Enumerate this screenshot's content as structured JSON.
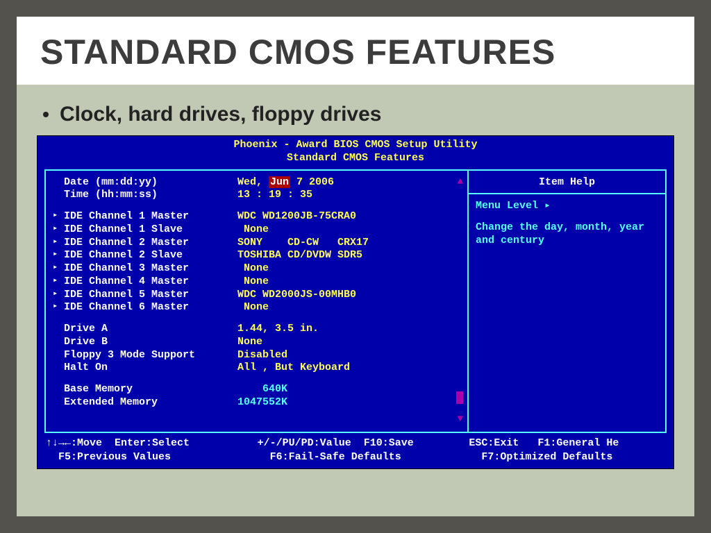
{
  "slide": {
    "title": "STANDARD CMOS FEATURES",
    "bullet": "Clock, hard drives, floppy drives"
  },
  "bios": {
    "header": {
      "line1": "Phoenix - Award BIOS CMOS Setup Utility",
      "line2": "Standard CMOS Features"
    },
    "left": {
      "date": {
        "label": "Date (mm:dd:yy)",
        "dow": "Wed,",
        "month": "Jun",
        "day_year": " 7 2006"
      },
      "time": {
        "label": "Time (hh:mm:ss)",
        "value": "13 : 19 : 35"
      },
      "ide": [
        {
          "label": "IDE Channel 1 Master",
          "value": "WDC WD1200JB-75CRA0"
        },
        {
          "label": "IDE Channel 1 Slave",
          "value": " None"
        },
        {
          "label": "IDE Channel 2 Master",
          "value": "SONY    CD-CW   CRX17"
        },
        {
          "label": "IDE Channel 2 Slave",
          "value": "TOSHIBA CD/DVDW SDR5"
        },
        {
          "label": "IDE Channel 3 Master",
          "value": " None"
        },
        {
          "label": "IDE Channel 4 Master",
          "value": " None"
        },
        {
          "label": "IDE Channel 5 Master",
          "value": "WDC WD2000JS-00MHB0"
        },
        {
          "label": "IDE Channel 6 Master",
          "value": " None"
        }
      ],
      "drives": [
        {
          "label": "Drive A",
          "value": "1.44, 3.5 in."
        },
        {
          "label": "Drive B",
          "value": "None"
        },
        {
          "label": "Floppy 3 Mode Support",
          "value": "Disabled"
        },
        {
          "label": "Halt On",
          "value": "All , But Keyboard"
        }
      ],
      "memory": [
        {
          "label": "Base Memory",
          "value": "    640K"
        },
        {
          "label": "Extended Memory",
          "value": "1047552K"
        }
      ]
    },
    "right": {
      "title": "Item Help",
      "menu_level": "Menu Level    ▸",
      "help_text": "Change the day, month, year and century"
    },
    "footer": {
      "l1a": "↑↓→←:Move  Enter:Select",
      "l1b": "+/-/PU/PD:Value  F10:Save",
      "l1c": "ESC:Exit   F1:General He",
      "l2a": "  F5:Previous Values",
      "l2b": "  F6:Fail-Safe Defaults",
      "l2c": "  F7:Optimized Defaults"
    }
  }
}
